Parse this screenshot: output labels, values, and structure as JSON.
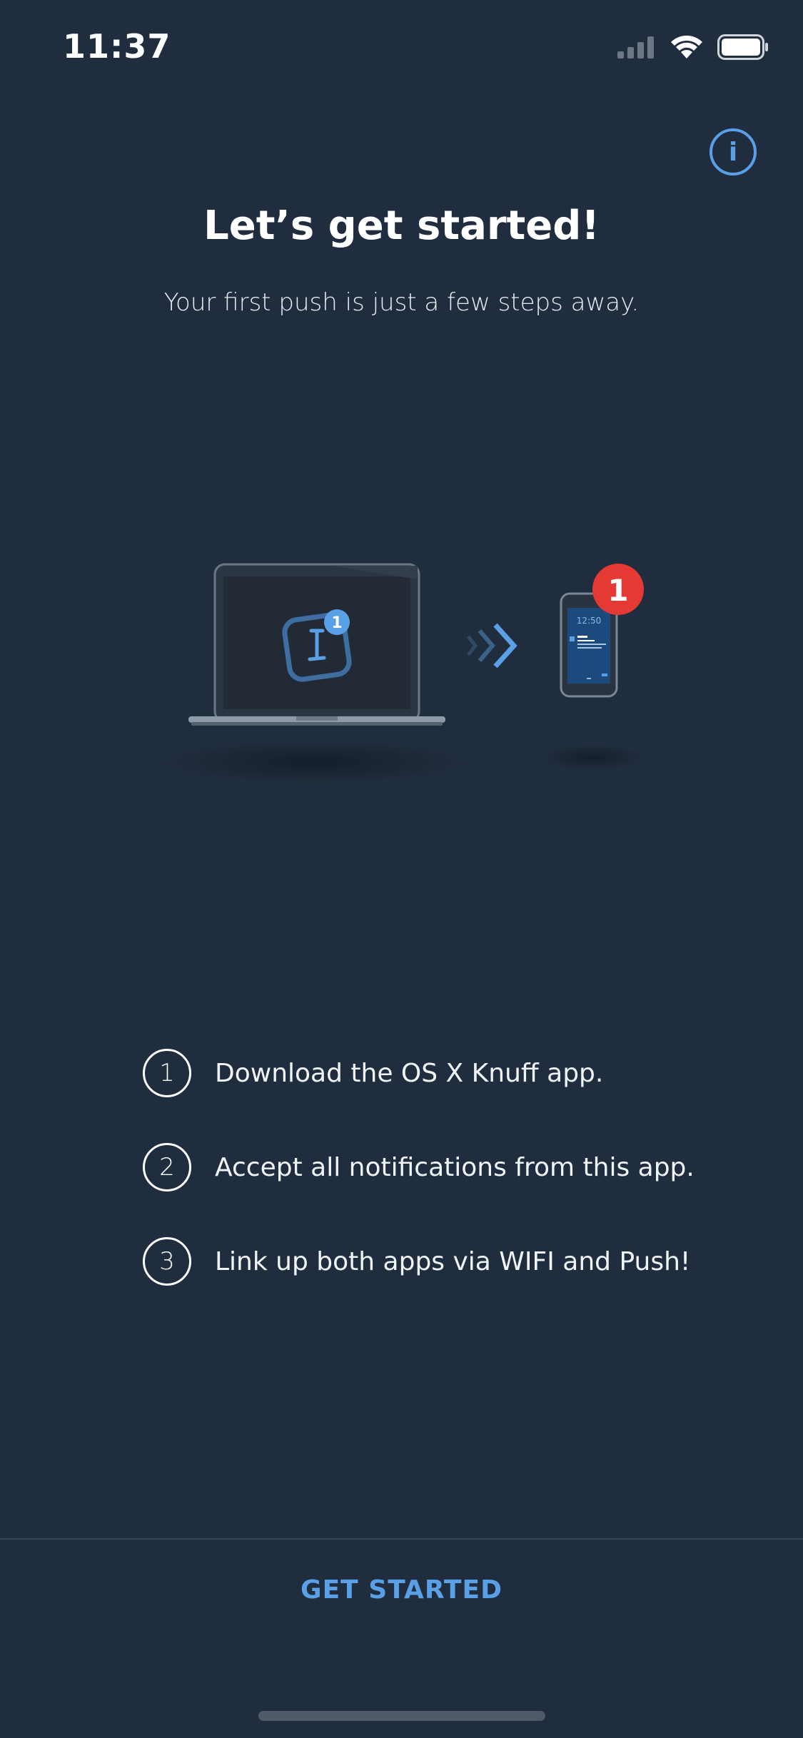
{
  "status_bar": {
    "time": "11:37"
  },
  "header": {
    "info_label": "i",
    "title": "Let’s get started!",
    "subtitle": "Your first push is just a few steps away."
  },
  "illustration": {
    "app_badge": "1",
    "phone_badge": "1",
    "phone_time": "12:50"
  },
  "steps": [
    {
      "number": "1",
      "text": "Download the OS X Knuff app."
    },
    {
      "number": "2",
      "text": "Accept all notifications from this app."
    },
    {
      "number": "3",
      "text": "Link up both apps via WIFI and Push!"
    }
  ],
  "footer": {
    "button_label": "GET STARTED"
  },
  "colors": {
    "background": "#202d3e",
    "accent": "#5aa0e6",
    "badge_red": "#e53935"
  }
}
